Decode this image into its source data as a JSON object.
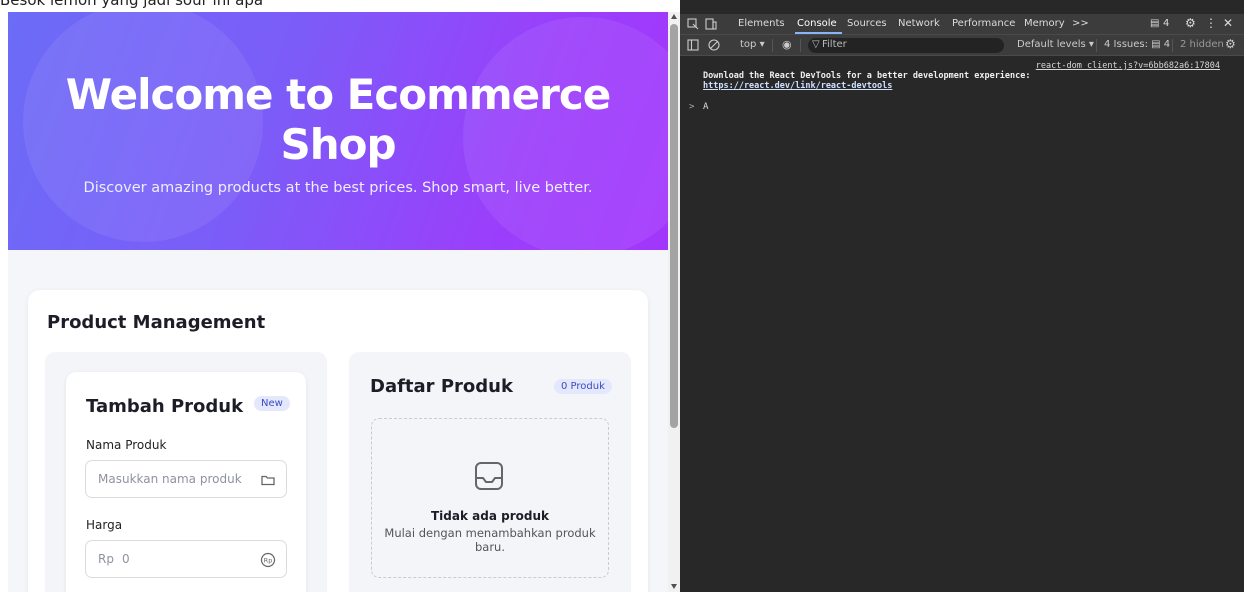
{
  "page_top_text": "Besok lemon yang jadi sour ini apa",
  "hero": {
    "title": "Welcome to Ecommerce Shop",
    "subtitle": "Discover amazing products at the best prices. Shop smart, live better."
  },
  "product_management": {
    "title": "Product Management",
    "add_form": {
      "title": "Tambah Produk",
      "badge": "New",
      "name_label": "Nama Produk",
      "name_placeholder": "Masukkan nama produk",
      "price_label": "Harga",
      "price_prefix": "Rp",
      "price_placeholder": "0"
    },
    "product_list": {
      "title": "Daftar Produk",
      "count_badge": "0 Produk",
      "empty_title": "Tidak ada produk",
      "empty_subtitle": "Mulai dengan menambahkan produk baru."
    }
  },
  "devtools": {
    "tabs": [
      "Elements",
      "Console",
      "Sources",
      "Network",
      "Performance",
      "Memory"
    ],
    "active_tab": "Console",
    "more_tabs": ">>",
    "issues_badge": "4",
    "toolbar": {
      "context": "top",
      "filter_placeholder": "Filter",
      "levels": "Default levels",
      "issues": "4 Issues:",
      "issues_count": "4",
      "hidden": "2 hidden"
    },
    "console": {
      "source_link": "react-dom_client.js?v=6bb682a6:17804",
      "message": "Download the React DevTools for a better development experience:",
      "link": "https://react.dev/link/react-devtools",
      "prompt": ">",
      "input": "A"
    }
  },
  "colors": {
    "hero_start": "#6b6cf7",
    "hero_end": "#a336fc",
    "badge_bg": "#e3e8fc",
    "badge_text": "#3b4cc0",
    "devtools_bg": "#282828"
  }
}
